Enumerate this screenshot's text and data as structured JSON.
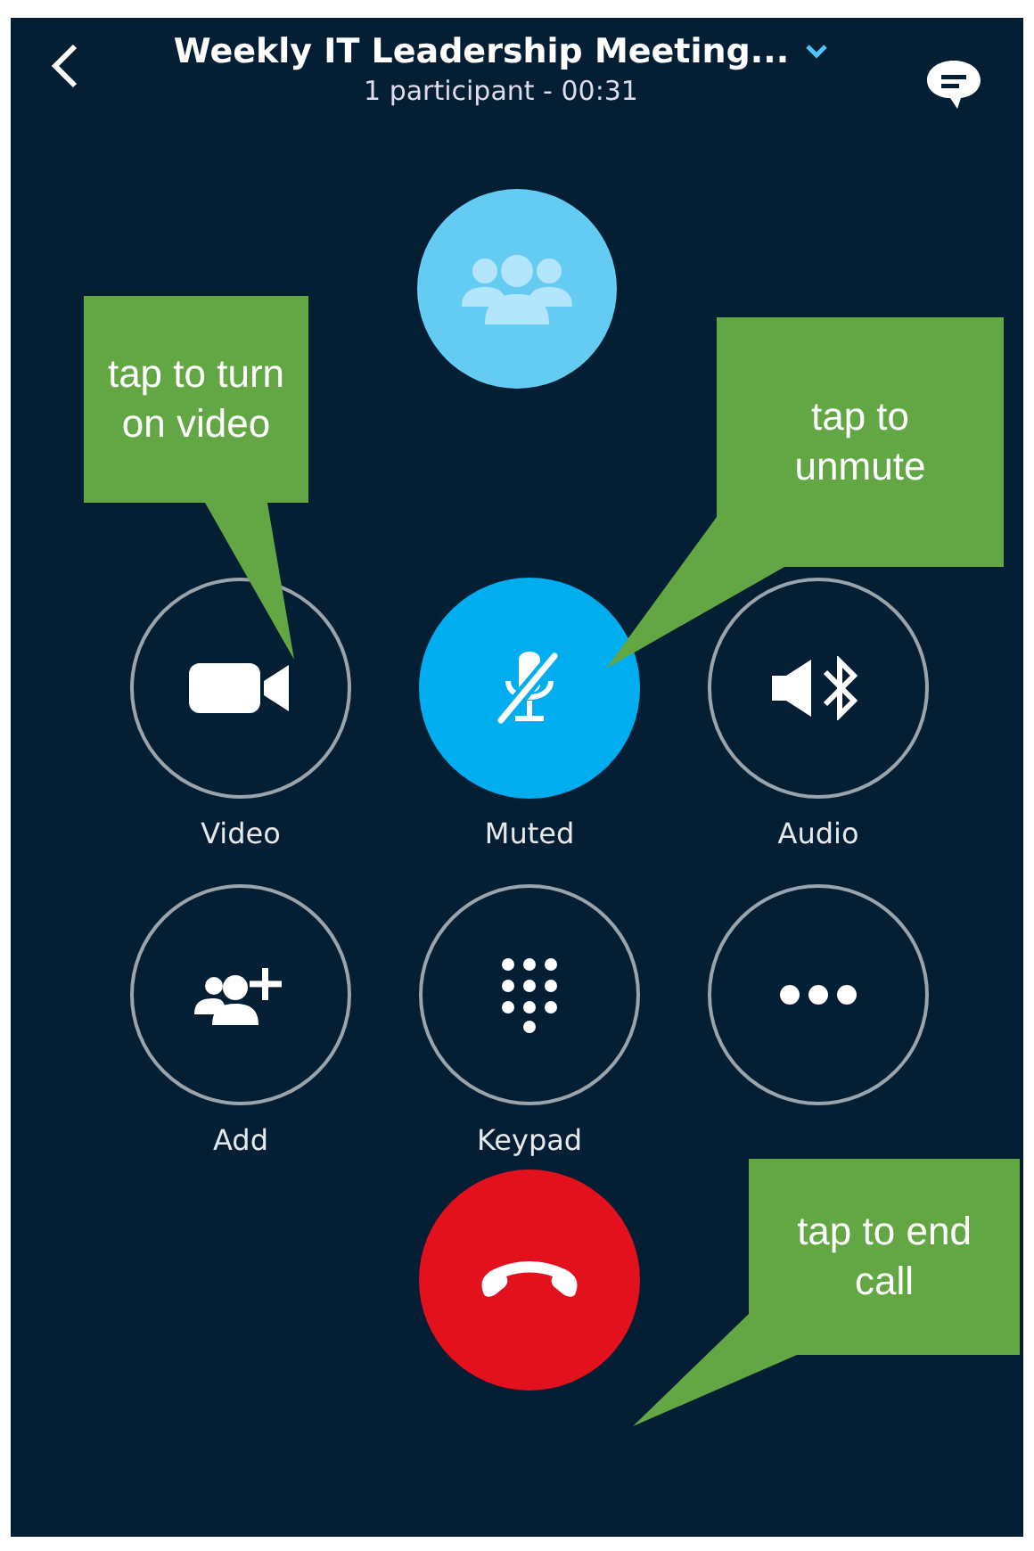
{
  "header": {
    "title": "Weekly IT Leadership Meeting...",
    "subtitle": "1 participant - 00:31"
  },
  "controls": [
    {
      "kind": "video",
      "label": "Video",
      "active": false
    },
    {
      "kind": "mute",
      "label": "Muted",
      "active": true
    },
    {
      "kind": "audio",
      "label": "Audio",
      "active": false
    },
    {
      "kind": "add",
      "label": "Add",
      "active": false
    },
    {
      "kind": "keypad",
      "label": "Keypad",
      "active": false
    },
    {
      "kind": "more",
      "active": false
    }
  ],
  "callouts": [
    {
      "text": "tap to turn on video"
    },
    {
      "text": "tap to unmute"
    },
    {
      "text": "tap to end call"
    }
  ]
}
